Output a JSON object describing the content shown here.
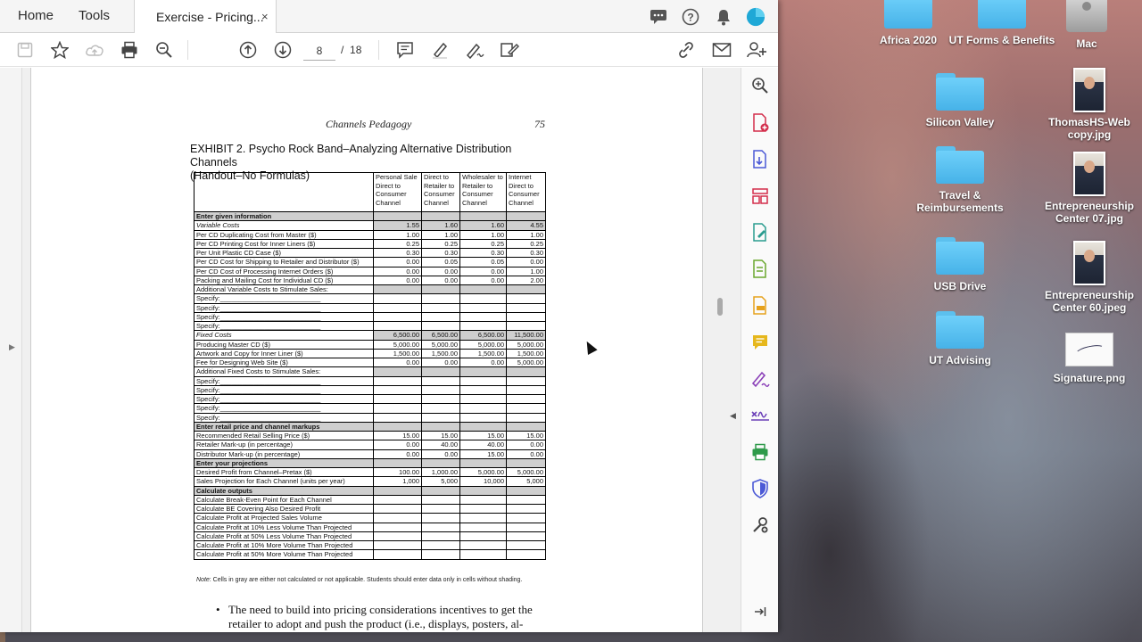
{
  "app": {
    "nav_home": "Home",
    "nav_tools": "Tools",
    "doc_tab_title": "Exercise - Pricing...",
    "doc_tab_close": "×",
    "page_current": "8",
    "page_sep": "/",
    "page_total": "18",
    "toolbar_icons": [
      "save-icon",
      "bookmark-star-icon",
      "upload-cloud-icon",
      "print-icon",
      "zoom-out-icon",
      "page-up-icon",
      "page-down-icon",
      "comment-icon",
      "highlight-icon",
      "sign-icon",
      "fill-form-icon",
      "share-link-icon",
      "email-icon",
      "add-user-icon"
    ],
    "right_panel_icons": [
      "zoom-icon",
      "create-pdf-icon",
      "export-pdf-icon",
      "organize-pages-icon",
      "edit-pdf-icon",
      "compress-icon",
      "scan-icon",
      "comment-icon",
      "fill-sign-icon",
      "signature-icon",
      "print-production-icon",
      "protect-icon",
      "more-tools-icon"
    ],
    "accent": "#d32d4b"
  },
  "document": {
    "running_head": "Channels Pedagogy",
    "page_number": "75",
    "exhibit_title": "EXHIBIT 2. Psycho Rock Band–Analyzing Alternative Distribution Channels",
    "exhibit_subtitle": "(Handout–No Formulas)",
    "columns": [
      "Personal Sale Direct to Consumer Channel",
      "Direct to Retailer to Consumer Channel",
      "Wholesaler to Retailer to Consumer Channel",
      "Internet Direct to Consumer Channel"
    ],
    "rows": [
      {
        "label": "Enter given information",
        "type": "section",
        "values": [
          "",
          "",
          "",
          ""
        ]
      },
      {
        "label": "Variable Costs",
        "type": "italic",
        "values": [
          "1.55",
          "1.60",
          "1.60",
          "4.55"
        ]
      },
      {
        "label": "Per CD Duplicating Cost from Master ($)",
        "values": [
          "1.00",
          "1.00",
          "1.00",
          "1.00"
        ]
      },
      {
        "label": "Per CD Printing Cost for Inner Liners ($)",
        "values": [
          "0.25",
          "0.25",
          "0.25",
          "0.25"
        ]
      },
      {
        "label": "Per Unit Plastic CD Case ($)",
        "values": [
          "0.30",
          "0.30",
          "0.30",
          "0.30"
        ]
      },
      {
        "label": "Per CD Cost for Shipping to Retailer and Distributor ($)",
        "values": [
          "0.00",
          "0.05",
          "0.05",
          "0.00"
        ]
      },
      {
        "label": "Per CD Cost of Processing Internet Orders ($)",
        "values": [
          "0.00",
          "0.00",
          "0.00",
          "1.00"
        ]
      },
      {
        "label": "Packing and Mailing Cost for Individual CD ($)",
        "values": [
          "0.00",
          "0.00",
          "0.00",
          "2.00"
        ]
      },
      {
        "label": "Additional Variable Costs to Stimulate Sales:",
        "type": "gray",
        "values": [
          "",
          "",
          "",
          ""
        ]
      },
      {
        "label": "Specify:___________________________",
        "values": [
          "",
          "",
          "",
          ""
        ]
      },
      {
        "label": "Specify:___________________________",
        "values": [
          "",
          "",
          "",
          ""
        ]
      },
      {
        "label": "Specify:___________________________",
        "values": [
          "",
          "",
          "",
          ""
        ]
      },
      {
        "label": "Specify:___________________________",
        "values": [
          "",
          "",
          "",
          ""
        ]
      },
      {
        "label": "Fixed Costs",
        "type": "italic",
        "values": [
          "6,500.00",
          "6,500.00",
          "6,500.00",
          "11,500.00"
        ]
      },
      {
        "label": "Producing Master CD ($)",
        "values": [
          "5,000.00",
          "5,000.00",
          "5,000.00",
          "5,000.00"
        ]
      },
      {
        "label": "Artwork and Copy for Inner Liner ($)",
        "values": [
          "1,500.00",
          "1,500.00",
          "1,500.00",
          "1,500.00"
        ]
      },
      {
        "label": "Fee for Designing Web Site ($)",
        "values": [
          "0.00",
          "0.00",
          "0.00",
          "5,000.00"
        ]
      },
      {
        "label": "Additional Fixed Costs to Stimulate Sales:",
        "type": "gray",
        "values": [
          "",
          "",
          "",
          ""
        ]
      },
      {
        "label": "Specify:___________________________",
        "values": [
          "",
          "",
          "",
          ""
        ]
      },
      {
        "label": "Specify:___________________________",
        "values": [
          "",
          "",
          "",
          ""
        ]
      },
      {
        "label": "Specify:___________________________",
        "values": [
          "",
          "",
          "",
          ""
        ]
      },
      {
        "label": "Specify:___________________________",
        "values": [
          "",
          "",
          "",
          ""
        ]
      },
      {
        "label": "Specify:___________________________",
        "values": [
          "",
          "",
          "",
          ""
        ]
      },
      {
        "label": "Enter retail price and channel markups",
        "type": "section",
        "values": [
          "",
          "",
          "",
          ""
        ]
      },
      {
        "label": "Recommended Retail Selling Price ($)",
        "values": [
          "15.00",
          "15.00",
          "15.00",
          "15.00"
        ]
      },
      {
        "label": "Retailer Mark-up (in percentage)",
        "values": [
          "0.00",
          "40.00",
          "40.00",
          "0.00"
        ]
      },
      {
        "label": "Distributor Mark-up (in percentage)",
        "values": [
          "0.00",
          "0.00",
          "15.00",
          "0.00"
        ]
      },
      {
        "label": "Enter your projections",
        "type": "section",
        "values": [
          "",
          "",
          "",
          ""
        ]
      },
      {
        "label": "Desired Profit from Channel–Pretax ($)",
        "values": [
          "100.00",
          "1,000.00",
          "5,000.00",
          "5,000.00"
        ]
      },
      {
        "label": "Sales Projection for Each Channel (units per year)",
        "values": [
          "1,000",
          "5,000",
          "10,000",
          "5,000"
        ]
      },
      {
        "label": "Calculate outputs",
        "type": "section",
        "values": [
          "",
          "",
          "",
          ""
        ]
      },
      {
        "label": "Calculate Break-Even Point for Each Channel",
        "values": [
          "",
          "",
          "",
          ""
        ]
      },
      {
        "label": "Calculate BE Covering Also Desired Profit",
        "values": [
          "",
          "",
          "",
          ""
        ]
      },
      {
        "label": "Calculate Profit at Projected Sales Volume",
        "values": [
          "",
          "",
          "",
          ""
        ]
      },
      {
        "label": "Calculate Profit at 10% Less Volume Than Projected",
        "values": [
          "",
          "",
          "",
          ""
        ]
      },
      {
        "label": "Calculate Profit at 50% Less Volume Than Projected",
        "values": [
          "",
          "",
          "",
          ""
        ]
      },
      {
        "label": "Calculate Profit at 10% More Volume Than Projected",
        "values": [
          "",
          "",
          "",
          ""
        ]
      },
      {
        "label": "Calculate Profit at 50% More Volume Than Projected",
        "values": [
          "",
          "",
          "",
          ""
        ]
      }
    ],
    "note_label": "Note",
    "note_text": ": Cells in gray are either not calculated or not applicable. Students should enter data only in cells without shading.",
    "bullet_text": "The need to build into pricing considerations incentives to get the retailer to adopt and push the product (i.e., displays, posters, al-"
  },
  "desktop": {
    "icons": [
      {
        "label": "Africa 2020",
        "kind": "folder"
      },
      {
        "label": "UT Forms & Benefits",
        "kind": "folder"
      },
      {
        "label": "Mac",
        "kind": "disk"
      },
      {
        "label": "Silicon Valley",
        "kind": "folder"
      },
      {
        "label": "ThomasHS-Web copy.jpg",
        "kind": "photo"
      },
      {
        "label": "Travel & Reimbursements",
        "kind": "folder"
      },
      {
        "label": "Entrepreneurship Center 07.jpg",
        "kind": "photo"
      },
      {
        "label": "USB Drive",
        "kind": "folder"
      },
      {
        "label": "Entrepreneurship Center 60.jpeg",
        "kind": "photo"
      },
      {
        "label": "UT Advising",
        "kind": "folder"
      },
      {
        "label": "Signature.png",
        "kind": "signature"
      }
    ]
  }
}
